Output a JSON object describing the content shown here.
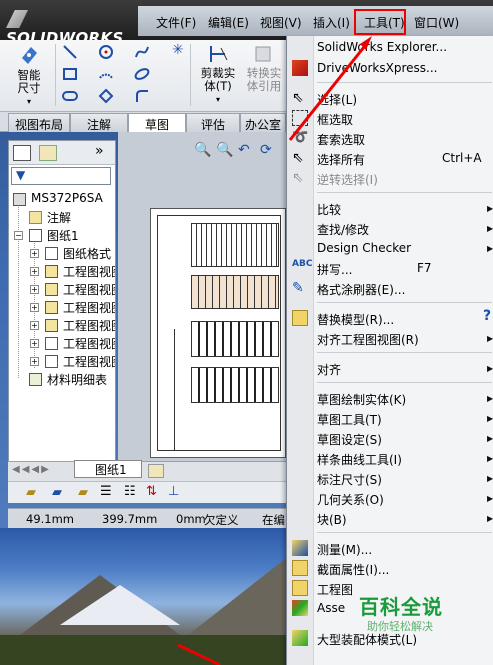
{
  "app": {
    "logo": "SOLIDWORKS"
  },
  "menubar": [
    {
      "label": "文件(F)"
    },
    {
      "label": "编辑(E)"
    },
    {
      "label": "视图(V)"
    },
    {
      "label": "插入(I)"
    },
    {
      "label": "工具(T)"
    },
    {
      "label": "窗口(W)"
    }
  ],
  "commands": {
    "smart_dimension": "智能尺寸",
    "trim_entities": "剪裁实体(T)",
    "convert_entities": "转换实体引用"
  },
  "tabs": [
    {
      "label": "视图布局"
    },
    {
      "label": "注解"
    },
    {
      "label": "草图"
    },
    {
      "label": "评估"
    },
    {
      "label": "办公室"
    }
  ],
  "tree": {
    "root": "MS372P6SA",
    "annotations": "注解",
    "sheet": "图纸1",
    "items": [
      "图纸格式",
      "工程图视图",
      "工程图视图",
      "工程图视图",
      "工程图视图",
      "工程图视图",
      "工程图视图"
    ],
    "bom": "材料明细表"
  },
  "sheet_tab": "图纸1",
  "status": {
    "x": "49.1mm",
    "y": "399.7mm",
    "z": "0mm",
    "state": "欠定义",
    "editing": "在编"
  },
  "tools_menu": {
    "items": [
      {
        "label": "SolidWorks Explorer...",
        "disabled": false
      },
      {
        "label": "DriveWorksXpress...",
        "disabled": false
      },
      {
        "label": "选择(L)",
        "disabled": false
      },
      {
        "label": "框选取",
        "disabled": false
      },
      {
        "label": "套索选取",
        "disabled": false
      },
      {
        "label": "选择所有",
        "disabled": false,
        "shortcut": "Ctrl+A"
      },
      {
        "label": "逆转选择(I)",
        "disabled": true
      },
      {
        "label": "比较",
        "disabled": false,
        "submenu": true
      },
      {
        "label": "查找/修改",
        "disabled": false,
        "submenu": true
      },
      {
        "label": "Design Checker",
        "disabled": false,
        "submenu": true
      },
      {
        "label": "拼写...",
        "disabled": false,
        "shortcut": "F7"
      },
      {
        "label": "格式涂刷器(E)...",
        "disabled": false
      },
      {
        "label": "替换模型(R)...",
        "disabled": false
      },
      {
        "label": "对齐工程图视图(R)",
        "disabled": false,
        "submenu": true
      },
      {
        "label": "对齐",
        "disabled": false,
        "submenu": true
      },
      {
        "label": "草图绘制实体(K)",
        "disabled": false,
        "submenu": true
      },
      {
        "label": "草图工具(T)",
        "disabled": false,
        "submenu": true
      },
      {
        "label": "草图设定(S)",
        "disabled": false,
        "submenu": true
      },
      {
        "label": "样条曲线工具(I)",
        "disabled": false,
        "submenu": true
      },
      {
        "label": "标注尺寸(S)",
        "disabled": false,
        "submenu": true
      },
      {
        "label": "几何关系(O)",
        "disabled": false,
        "submenu": true
      },
      {
        "label": "块(B)",
        "disabled": false,
        "submenu": true
      },
      {
        "label": "测量(M)...",
        "disabled": false
      },
      {
        "label": "截面属性(I)...",
        "disabled": false
      },
      {
        "label": "工程图",
        "disabled": false
      },
      {
        "label": "Asse",
        "disabled": false
      },
      {
        "label": "大型装配体模式(L)",
        "disabled": false
      }
    ]
  },
  "watermark": {
    "title": "百科全说",
    "subtitle": "助你轻松解决"
  },
  "colors": {
    "highlight_box": "#e00000",
    "arrow": "#e00000",
    "watermark": "#1a9a3a"
  }
}
